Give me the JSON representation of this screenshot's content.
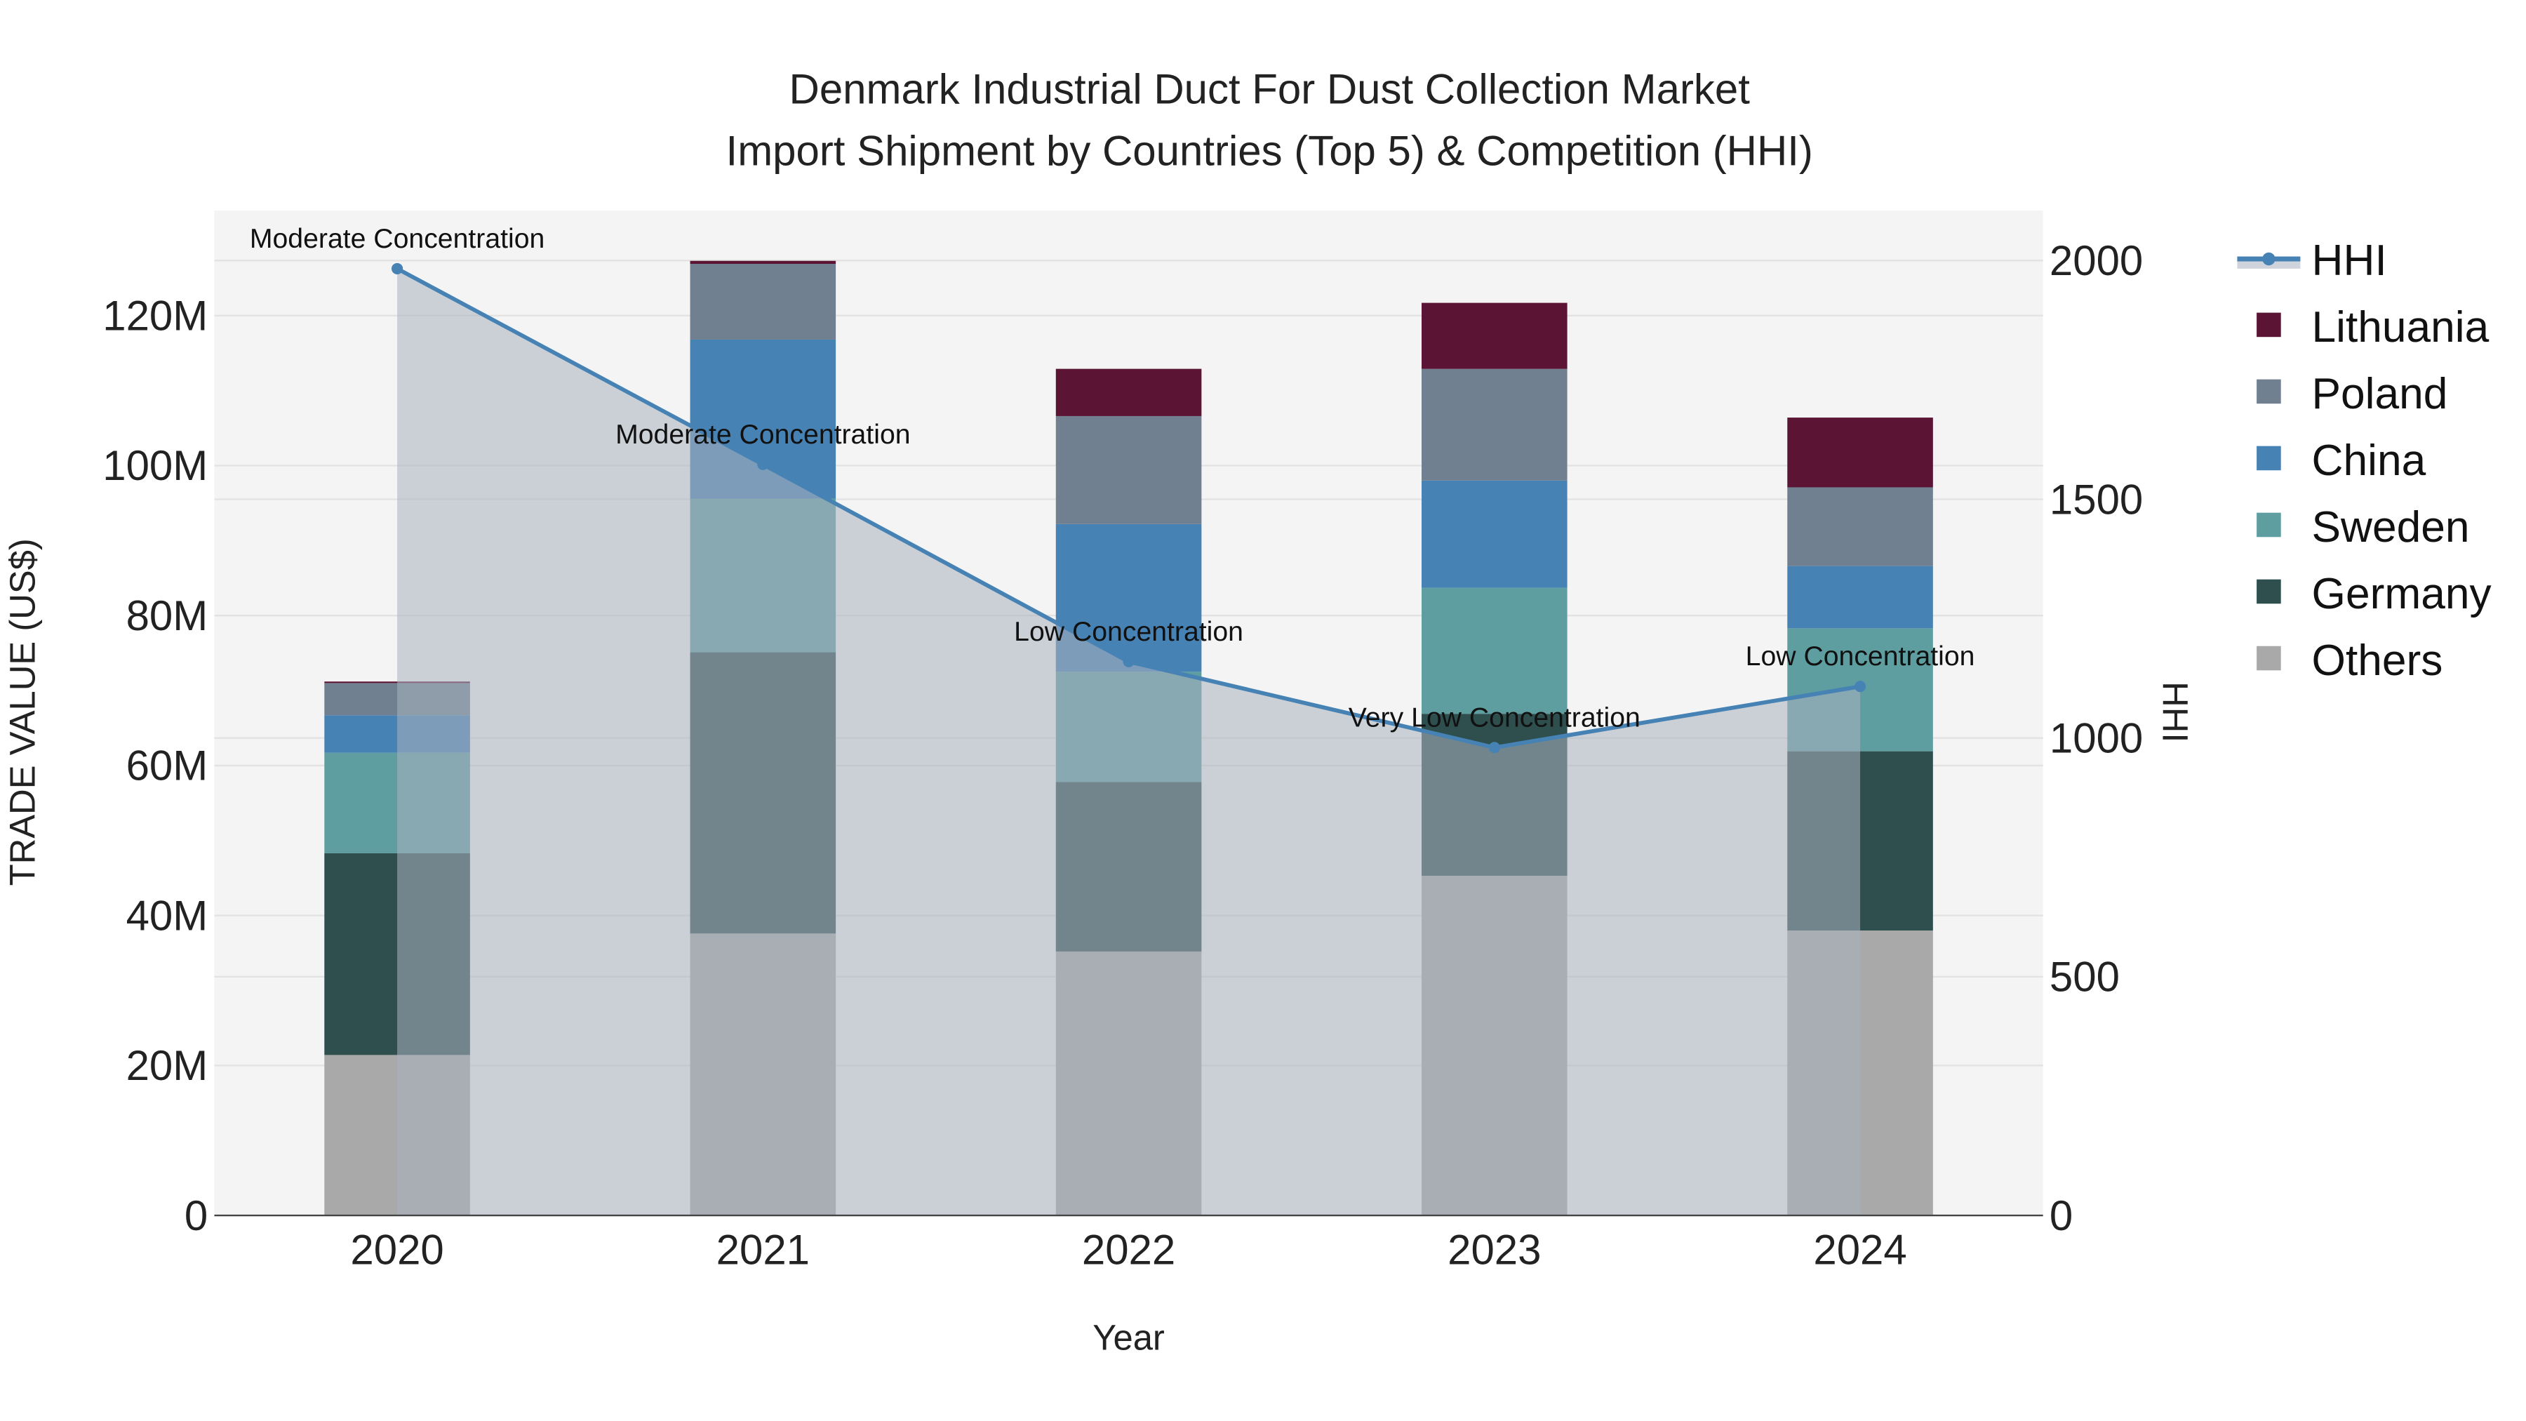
{
  "chart_data": {
    "type": "bar",
    "stacked": true,
    "title": "Denmark Industrial Duct For Dust Collection Market",
    "subtitle": "Import Shipment by Countries (Top 5) & Competition (HHI)",
    "xlabel": "Year",
    "ylabel": "TRADE VALUE (US$)",
    "y2label": "HHI",
    "categories": [
      "2020",
      "2021",
      "2022",
      "2023",
      "2024"
    ],
    "ylim": [
      0,
      130
    ],
    "y_ticks": [
      "0",
      "20M",
      "40M",
      "60M",
      "80M",
      "100M",
      "120M"
    ],
    "y_tick_values": [
      0,
      20,
      40,
      60,
      80,
      100,
      120
    ],
    "y2lim": [
      0,
      2100
    ],
    "y2_ticks": [
      "0",
      "500",
      "1000",
      "1500",
      "2000"
    ],
    "y2_tick_values": [
      0,
      500,
      1000,
      1500,
      2000
    ],
    "value_unit": "US$ millions",
    "grid": true,
    "legend_position": "right",
    "series": [
      {
        "name": "Others",
        "color": "#a9a9a9",
        "values": [
          21.4,
          37.6,
          35.2,
          45.3,
          38.0
        ]
      },
      {
        "name": "Germany",
        "color": "#2f4f4f",
        "values": [
          26.9,
          37.5,
          22.6,
          21.6,
          23.9
        ]
      },
      {
        "name": "Sweden",
        "color": "#5f9ea0",
        "values": [
          13.4,
          20.5,
          14.7,
          16.8,
          16.4
        ]
      },
      {
        "name": "China",
        "color": "#4682b4",
        "values": [
          5.0,
          21.2,
          19.7,
          14.3,
          8.3
        ]
      },
      {
        "name": "Poland",
        "color": "#708090",
        "values": [
          4.3,
          10.1,
          14.4,
          14.9,
          10.5
        ]
      },
      {
        "name": "Lithuania",
        "color": "#5c1434",
        "values": [
          0.2,
          0.4,
          6.3,
          8.8,
          9.3
        ]
      }
    ],
    "hhi": {
      "name": "HHI",
      "color": "#4682b4",
      "values": [
        1983,
        1573,
        1160,
        980,
        1108
      ],
      "annotations": [
        "Moderate Concentration",
        "Moderate Concentration",
        "Low Concentration",
        "Very Low Concentration",
        "Low Concentration"
      ]
    },
    "legend_order": [
      "HHI",
      "Lithuania",
      "Poland",
      "China",
      "Sweden",
      "Germany",
      "Others"
    ]
  }
}
